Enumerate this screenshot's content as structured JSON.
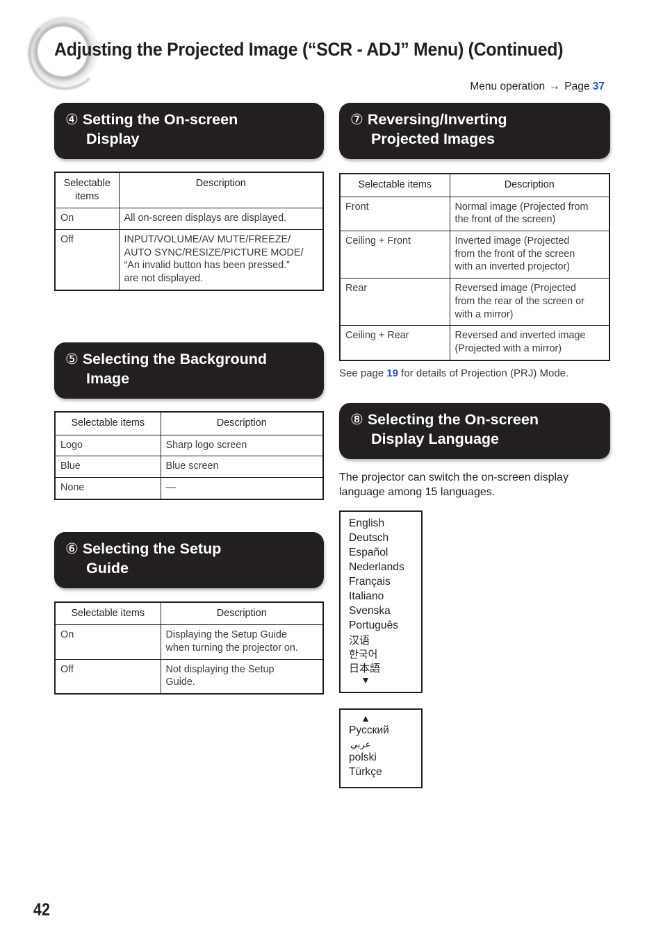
{
  "page": {
    "title": "Adjusting the Projected Image (“SCR - ADJ” Menu) (Continued)",
    "folio": "42",
    "menu_operation": {
      "label": "Menu operation",
      "arrow": "→",
      "page_word": "Page",
      "page_number": "37"
    },
    "accent_color": "#2b55b7",
    "banner_color": "#231f20"
  },
  "sections": {
    "s4": {
      "number": "④",
      "title_line1": "Setting the On-screen",
      "title_line2": "Display",
      "table": {
        "headers": [
          "Selectable items",
          "Description"
        ],
        "rows": [
          [
            "On",
            "All on-screen displays are displayed."
          ],
          [
            "Off",
            "INPUT/VOLUME/AV MUTE/FREEZE/\nAUTO SYNC/RESIZE/PICTURE MODE/\n“An invalid button has been pressed.”\nare not displayed."
          ]
        ]
      }
    },
    "s5": {
      "number": "⑤",
      "title_line1": "Selecting the Background",
      "title_line2": "Image",
      "table": {
        "headers": [
          "Selectable items",
          "Description"
        ],
        "rows": [
          [
            "Logo",
            "Sharp logo screen"
          ],
          [
            "Blue",
            "Blue screen"
          ],
          [
            "None",
            "—"
          ]
        ]
      }
    },
    "s6": {
      "number": "⑥",
      "title_line1": "Selecting the Setup",
      "title_line2": "Guide",
      "table": {
        "headers": [
          "Selectable items",
          "Description"
        ],
        "rows": [
          [
            "On",
            "Displaying the Setup Guide\nwhen turning the projector on."
          ],
          [
            "Off",
            "Not displaying the Setup\nGuide."
          ]
        ]
      }
    },
    "s7": {
      "number": "⑦",
      "title_line1": "Reversing/Inverting",
      "title_line2": "Projected Images",
      "table": {
        "headers": [
          "Selectable items",
          "Description"
        ],
        "rows": [
          [
            "Front",
            "Normal image (Projected from\nthe front of the screen)"
          ],
          [
            "Ceiling + Front",
            "Inverted image (Projected\nfrom the front of the screen\nwith an inverted projector)"
          ],
          [
            "Rear",
            "Reversed image (Projected\nfrom the rear of the screen or\nwith a mirror)"
          ],
          [
            "Ceiling + Rear",
            "Reversed and inverted image\n(Projected with a mirror)"
          ]
        ]
      },
      "note": {
        "before": "See page ",
        "page_number": "19",
        "after": " for details of Projection (PRJ) Mode."
      }
    },
    "s8": {
      "number": "⑧",
      "title_line1": "Selecting the On-screen",
      "title_line2": "Display Language",
      "intro": "The projector can switch the on-screen display language among 15 languages.",
      "language_box_1": {
        "items": [
          "English",
          "Deutsch",
          "Español",
          "Nederlands",
          "Français",
          "Italiano",
          "Svenska",
          "Português",
          "汉语",
          "한국어",
          "日本語"
        ],
        "scroll_arrow": "▼"
      },
      "language_box_2": {
        "scroll_arrow": "▲",
        "items": [
          "Русский",
          "عربي",
          "polski",
          "Türkçe"
        ]
      }
    }
  }
}
